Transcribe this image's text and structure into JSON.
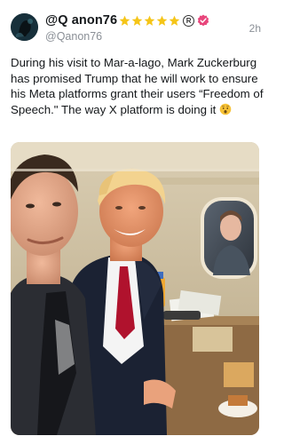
{
  "post": {
    "display_name": "@Q anon76",
    "handle": "@Qanon76",
    "time": "2h",
    "reg_mark": "R",
    "text_part1": "During his visit to Mar-a-lago, Mark Zuckerburg has promised Trump that he will work to ensure his Meta platforms grant their users “Freedom of Speech.\" The way X platform is doing it",
    "badges": [
      "star-icon",
      "star-icon",
      "star-icon",
      "star-icon",
      "star-icon",
      "registered-icon",
      "verified-badge-icon"
    ],
    "emoji": "hushed-face-emoji"
  },
  "colors": {
    "star": "#f5c518",
    "verified": "#e8467c",
    "muted_text": "#8a8f96"
  }
}
